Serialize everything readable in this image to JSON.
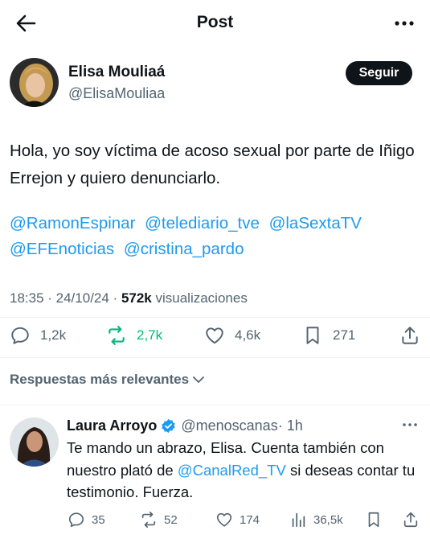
{
  "header": {
    "title": "Post"
  },
  "post": {
    "author_name": "Elisa Mouliaá",
    "author_handle": "@ElisaMouliaa",
    "follow_label": "Seguir",
    "text": "Hola, yo soy víctima de acoso sexual por parte de Iñigo Errejon y quiero denunciarlo.",
    "mentions": [
      "@RamonEspinar",
      "@telediario_tve",
      "@laSextaTV",
      "@EFEnoticias",
      "@cristina_pardo"
    ],
    "time": "18:35 · 24/10/24 · ",
    "views_count": "572k",
    "views_label": " visualizaciones",
    "stats": {
      "replies": "1,2k",
      "reposts": "2,7k",
      "likes": "4,6k",
      "bookmarks": "271"
    }
  },
  "replies_sort_label": "Respuestas más relevantes",
  "reply": {
    "author_name": "Laura Arroyo",
    "author_handle": "@menoscanas",
    "time": "· 1h",
    "text_before": "Te mando un abrazo, Elisa. Cuenta  también con nuestro plató de ",
    "mention": "@CanalRed_TV",
    "text_after": " si deseas contar tu testimonio. Fuerza.",
    "stats": {
      "replies": "35",
      "reposts": "52",
      "likes": "174",
      "views": "36,5k"
    }
  },
  "colors": {
    "accent": "#1d9bf0",
    "repost_active": "#00ba7c",
    "text": "#0f1419",
    "muted": "#536471"
  }
}
